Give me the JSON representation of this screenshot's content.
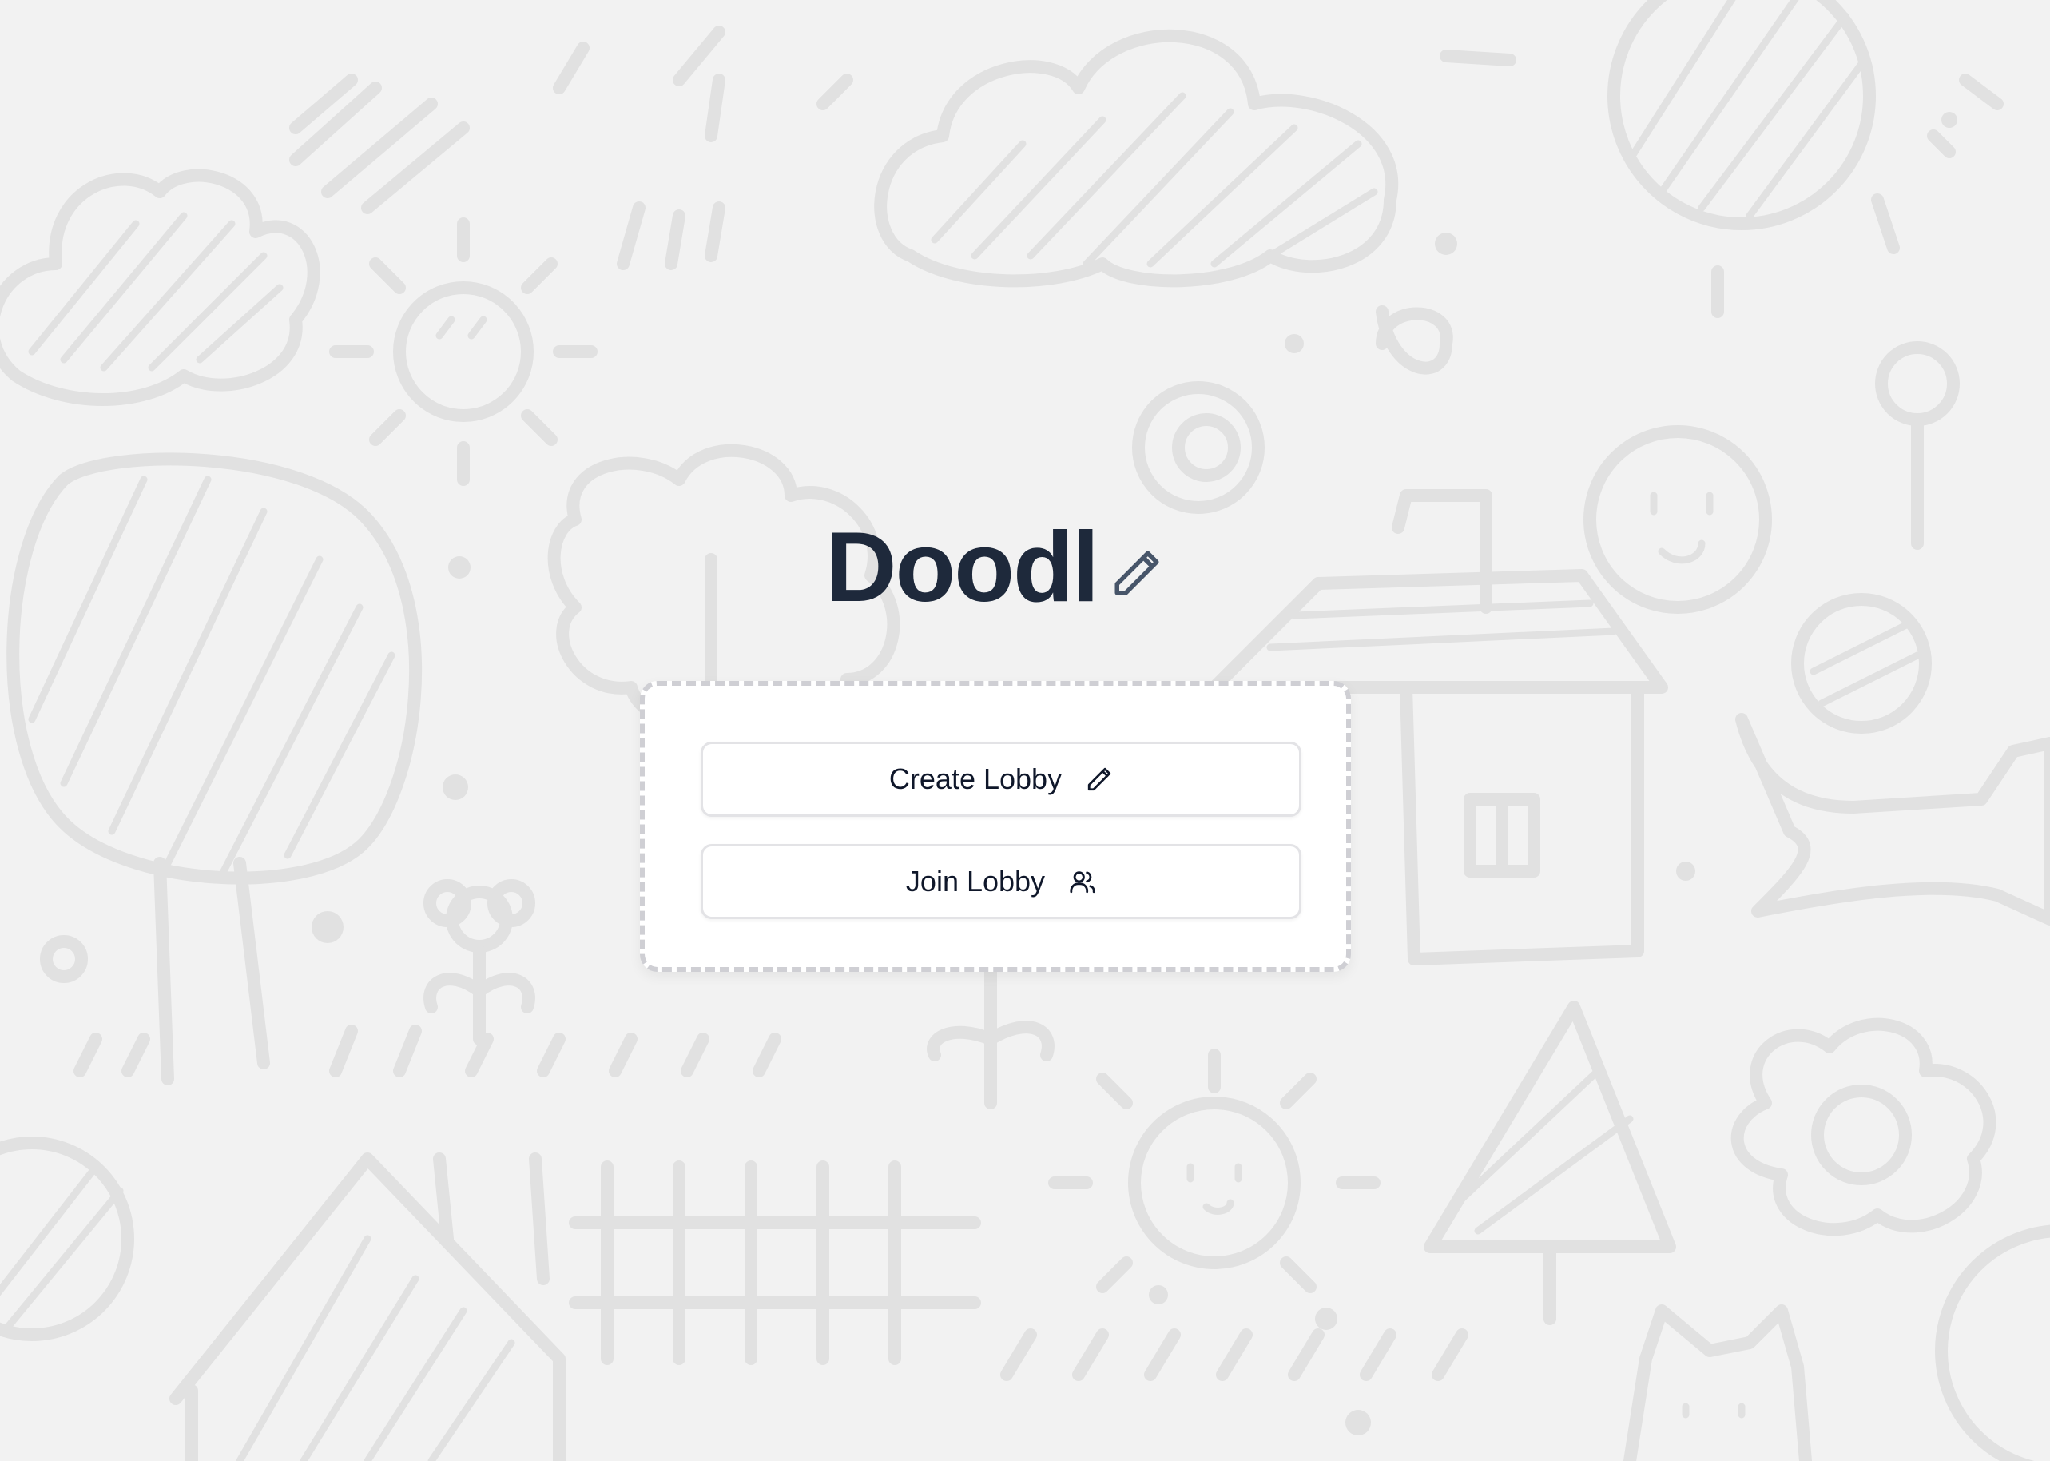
{
  "app": {
    "title": "Doodl",
    "title_icon": "pencil-icon"
  },
  "actions": {
    "create_label": "Create Lobby",
    "create_icon": "pencil-icon",
    "join_label": "Join Lobby",
    "join_icon": "users-icon"
  },
  "colors": {
    "background": "#f2f2f2",
    "doodle_stroke": "#e1e1e1",
    "title": "#1e293b",
    "card": "#ffffff",
    "card_border": "#cfcfd4",
    "button_border": "#e3e3e6",
    "button_text": "#0f172a"
  }
}
